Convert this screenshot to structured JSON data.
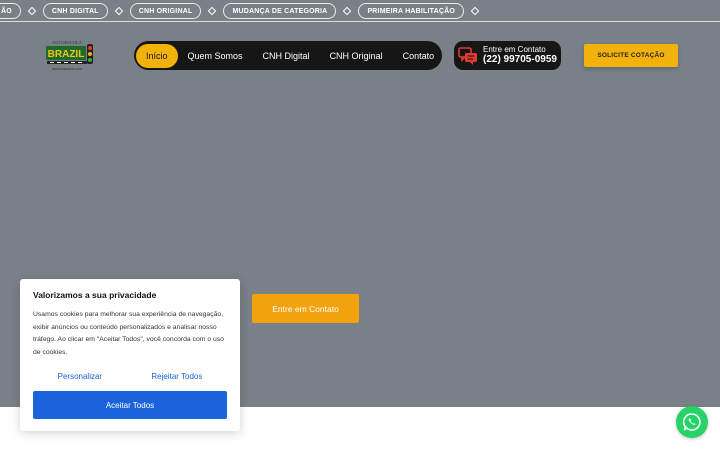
{
  "ticker": {
    "items": [
      "ÃO",
      "CNH DIGITAL",
      "CNH ORIGINAL",
      "MUDANÇA DE CATEGORIA",
      "PRIMEIRA HABILITAÇÃO"
    ]
  },
  "logo": {
    "line1": "AUTOESCOLA",
    "line2": "BRAZIL",
    "line3": "www.brazilcnh.com"
  },
  "nav": {
    "items": [
      {
        "label": "Início",
        "active": true
      },
      {
        "label": "Quem Somos"
      },
      {
        "label": "CNH Digital"
      },
      {
        "label": "CNH Original"
      },
      {
        "label": "Contato"
      }
    ]
  },
  "contact": {
    "label": "Entre em Contato",
    "phone": "(22) 99705-0959",
    "icon": "chat-bubbles-icon"
  },
  "cta": {
    "label": "SOLICITE COTAÇÃO"
  },
  "hero": {
    "button_label": "Entre em Contato"
  },
  "cookie": {
    "title": "Valorizamos a sua privacidade",
    "body": "Usamos cookies para melhorar sua experiência de navegação, exibir anúncios ou conteúdo personalizados e analisar nosso tráfego. Ao clicar em \"Aceitar Todos\", você concorda com o uso de cookies.",
    "customize_label": "Personalizar",
    "reject_label": "Rejeitar Todos",
    "accept_label": "Aceitar Todos"
  },
  "whatsapp": {
    "icon": "whatsapp-icon"
  },
  "colors": {
    "accent": "#f3b20b",
    "hero_bg": "#7a8088",
    "nav_bg": "#161616",
    "cookie_blue": "#1a63dc",
    "whatsapp_green": "#25d366"
  }
}
